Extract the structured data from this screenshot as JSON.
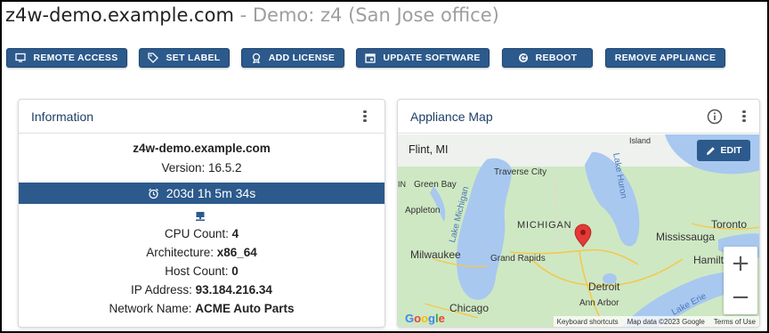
{
  "header": {
    "hostname": "z4w-demo.example.com",
    "separator": " - ",
    "subtitle": "Demo: z4 (San Jose office)"
  },
  "toolbar": {
    "remote_access": "REMOTE ACCESS",
    "set_label": "SET LABEL",
    "add_license": "ADD LICENSE",
    "update_software": "UPDATE SOFTWARE",
    "reboot": "REBOOT",
    "remove_appliance": "REMOVE APPLIANCE"
  },
  "info_card": {
    "title": "Information",
    "hostname": "z4w-demo.example.com",
    "version_label": "Version: ",
    "version": "16.5.2",
    "uptime": "203d 1h 5m 34s",
    "cpu_label": "CPU Count: ",
    "cpu_count": "4",
    "arch_label": "Architecture: ",
    "architecture": "x86_64",
    "host_label": "Host Count: ",
    "host_count": "0",
    "ip_label": "IP Address: ",
    "ip_address": "93.184.216.34",
    "network_label": "Network Name: ",
    "network_name": "ACME Auto Parts"
  },
  "map_card": {
    "title": "Appliance Map",
    "location": "Flint, MI",
    "edit_label": "EDIT",
    "zoom_in": "+",
    "zoom_out": "−",
    "labels": {
      "island": "Island",
      "traverse_city": "Traverse City",
      "green_bay": "Green Bay",
      "lake_michigan": "Lake Michigan",
      "lake_huron": "Lake Huron",
      "appleton": "Appleton",
      "michigan": "MICHIGAN",
      "toronto": "Toronto",
      "mississauga": "Mississauga",
      "hamilton": "Hamilt",
      "milwaukee": "Milwaukee",
      "grand_rapids": "Grand Rapids",
      "detroit": "Detroit",
      "chicago": "Chicago",
      "ann_arbor": "Ann Arbor",
      "lake_erie": "Lake Erie",
      "left_in": "IN"
    },
    "footer": {
      "shortcuts": "Keyboard shortcuts",
      "map_data": "Map data ©2023 Google",
      "terms": "Terms of Use"
    },
    "google": "Google",
    "colors": {
      "land": "#cfe8c4",
      "land_dark": "#b9dcaa",
      "water": "#a8c8ef",
      "road": "#f2c94c",
      "pin": "#e53935"
    }
  }
}
